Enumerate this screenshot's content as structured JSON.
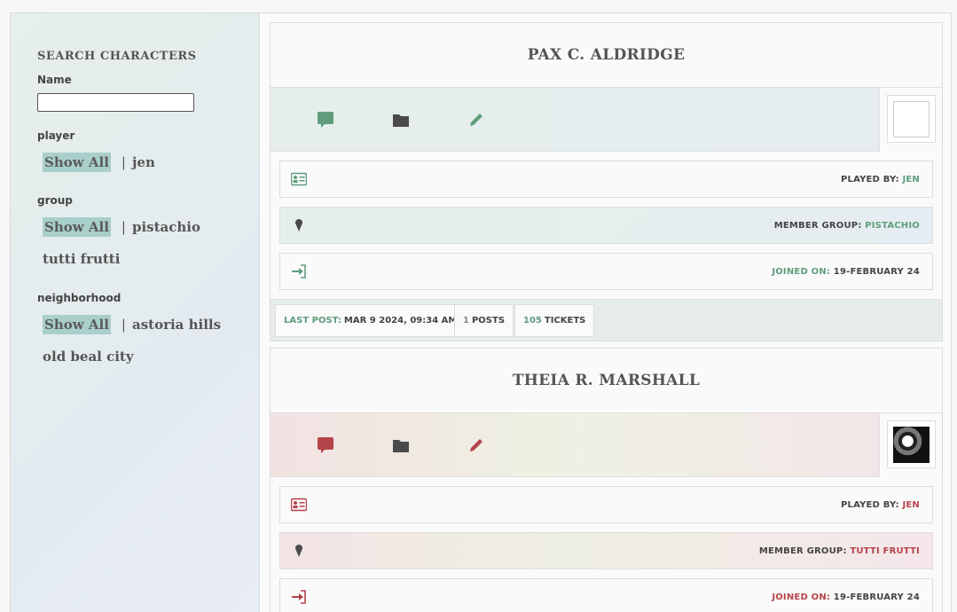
{
  "sidebar": {
    "title": "SEARCH CHARACTERS",
    "name_label": "Name",
    "name_value": "",
    "filters": [
      {
        "label": "player",
        "show_all": "Show All",
        "options": [
          "jen"
        ]
      },
      {
        "label": "group",
        "show_all": "Show All",
        "options": [
          "pistachio",
          "tutti frutti"
        ]
      },
      {
        "label": "neighborhood",
        "show_all": "Show All",
        "options": [
          "astoria hills",
          "old beal city"
        ]
      }
    ]
  },
  "characters": [
    {
      "name": "PAX C. ALDRIDGE",
      "accent": "#5f9d7d",
      "icons": [
        "speech-bubble-icon",
        "folder-icon",
        "pencil-icon"
      ],
      "played_by_label": "PLAYED BY:",
      "played_by": "JEN",
      "member_group_label": "MEMBER GROUP:",
      "member_group": "PISTACHIO",
      "joined_label": "JOINED ON:",
      "joined": "19-FEBRUARY 24",
      "last_post_label": "LAST POST:",
      "last_post": "MAR 9 2024, 09:34 AM",
      "posts_count": "1",
      "posts_label": "POSTS",
      "tickets_count": "105",
      "tickets_label": "TICKETS"
    },
    {
      "name": "THEIA R. MARSHALL",
      "accent": "#b5444a",
      "icons": [
        "speech-bubble-icon",
        "folder-icon",
        "pencil-icon"
      ],
      "played_by_label": "PLAYED BY:",
      "played_by": "JEN",
      "member_group_label": "MEMBER GROUP:",
      "member_group": "TUTTI FRUTTI",
      "joined_label": "JOINED ON:",
      "joined": "19-FEBRUARY 24"
    }
  ]
}
